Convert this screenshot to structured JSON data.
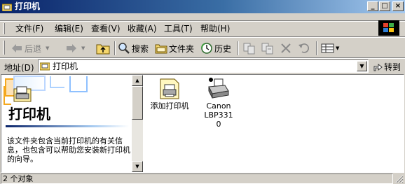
{
  "window": {
    "title": "打印机"
  },
  "title_buttons": [
    "_",
    "□",
    "×"
  ],
  "menu": [
    "文件(F)",
    "编辑(E)",
    "查看(V)",
    "收藏(A)",
    "工具(T)",
    "帮助(H)"
  ],
  "toolbar": {
    "back": "后退",
    "search": "搜索",
    "folders": "文件夹",
    "history": "历史"
  },
  "address": {
    "label": "地址(D)",
    "value": "打印机",
    "go": "转到"
  },
  "left_pane": {
    "title": "打印机",
    "description": "该文件夹包含当前打印机的有关信息，也包含可以帮助您安装新打印机的向导。"
  },
  "items": [
    {
      "label": "添加打印机",
      "icon": "add-printer-icon"
    },
    {
      "label": "Canon LBP3310",
      "icon": "printer-icon"
    }
  ],
  "status": {
    "text": "2 个对象"
  }
}
